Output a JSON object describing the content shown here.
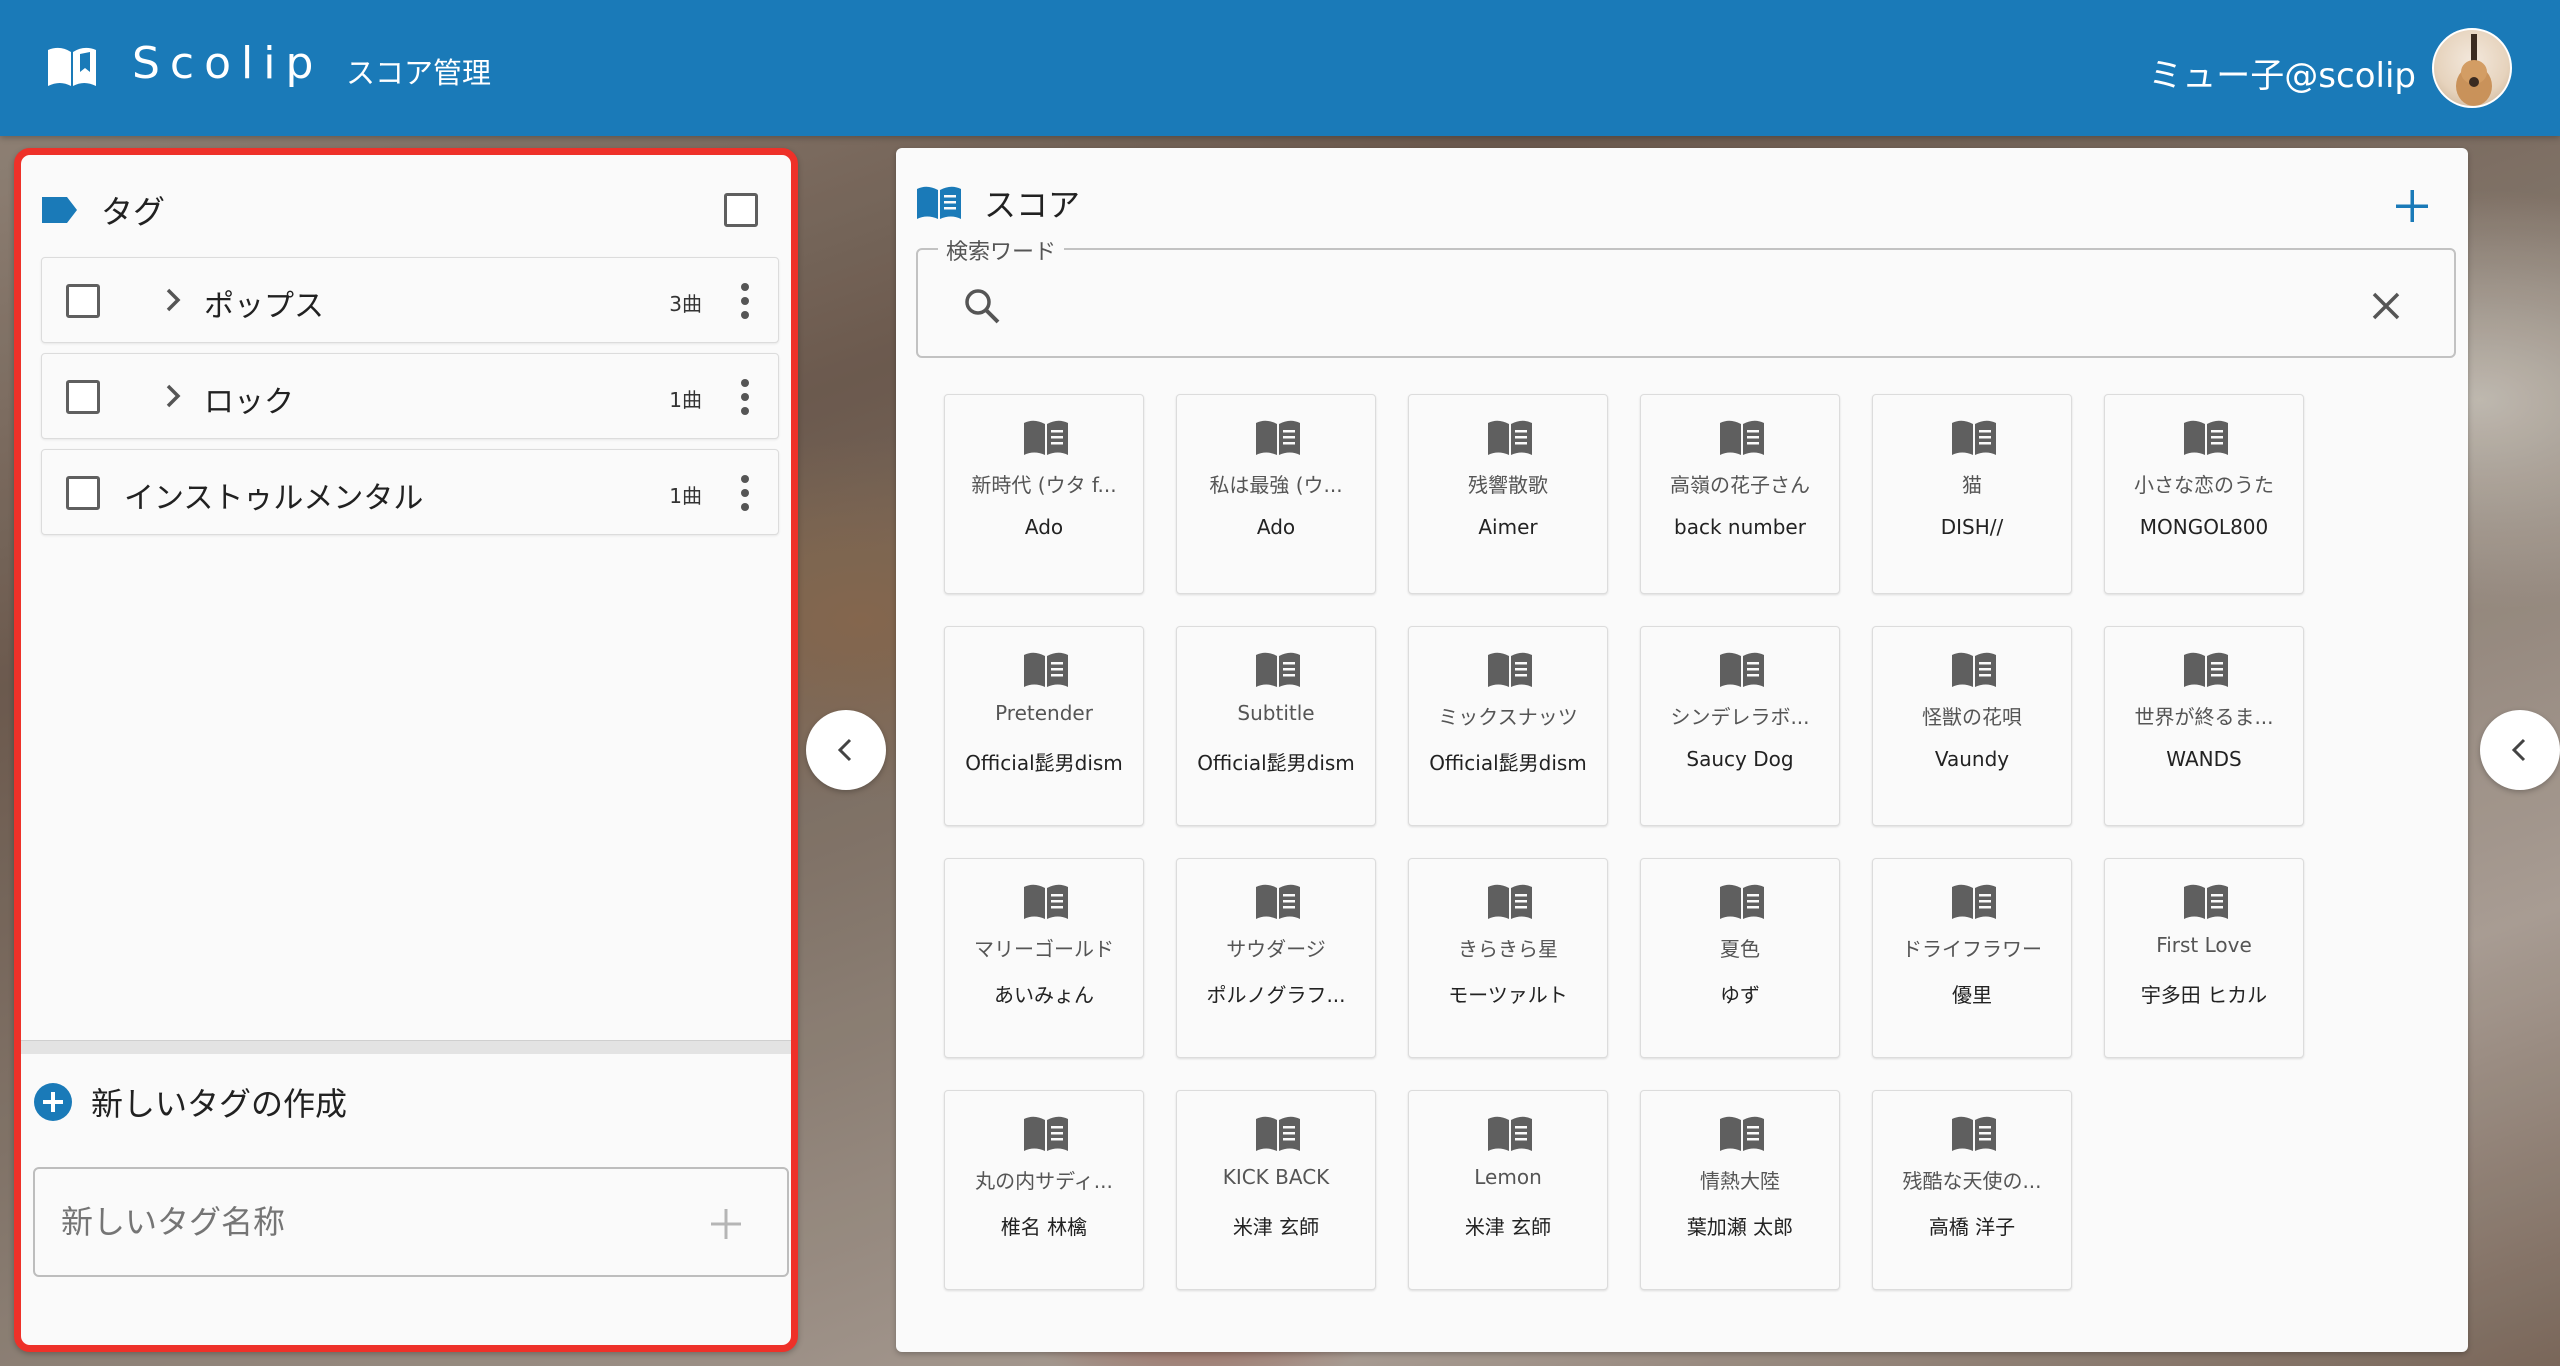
{
  "header": {
    "app_name": "Scolip",
    "nav_link": "スコア管理",
    "user_name": "ミュー子@scolip"
  },
  "tags_panel": {
    "title": "タグ",
    "items": [
      {
        "name": "ポップス",
        "count": "3曲",
        "expandable": true
      },
      {
        "name": "ロック",
        "count": "1曲",
        "expandable": true
      },
      {
        "name": "インストゥルメンタル",
        "count": "1曲",
        "expandable": false
      }
    ],
    "new_tag_heading": "新しいタグの作成",
    "new_tag_placeholder": "新しいタグ名称"
  },
  "scores_panel": {
    "title": "スコア",
    "search_label": "検索ワード",
    "search_value": "",
    "scores": [
      {
        "title": "新時代 (ウタ f...",
        "artist": "Ado"
      },
      {
        "title": "私は最強 (ウ...",
        "artist": "Ado"
      },
      {
        "title": "残響散歌",
        "artist": "Aimer"
      },
      {
        "title": "高嶺の花子さん",
        "artist": "back number"
      },
      {
        "title": "猫",
        "artist": "DISH//"
      },
      {
        "title": "小さな恋のうた",
        "artist": "MONGOL800"
      },
      {
        "title": "Pretender",
        "artist": "Official髭男dism"
      },
      {
        "title": "Subtitle",
        "artist": "Official髭男dism"
      },
      {
        "title": "ミックスナッツ",
        "artist": "Official髭男dism"
      },
      {
        "title": "シンデレラボ...",
        "artist": "Saucy Dog"
      },
      {
        "title": "怪獣の花唄",
        "artist": "Vaundy"
      },
      {
        "title": "世界が終るま...",
        "artist": "WANDS"
      },
      {
        "title": "マリーゴールド",
        "artist": "あいみょん"
      },
      {
        "title": "サウダージ",
        "artist": "ポルノグラフ..."
      },
      {
        "title": "きらきら星",
        "artist": "モーツァルト"
      },
      {
        "title": "夏色",
        "artist": "ゆず"
      },
      {
        "title": "ドライフラワー",
        "artist": "優里"
      },
      {
        "title": "First Love",
        "artist": "宇多田 ヒカル"
      },
      {
        "title": "丸の内サディ...",
        "artist": "椎名 林檎"
      },
      {
        "title": "KICK BACK",
        "artist": "米津 玄師"
      },
      {
        "title": "Lemon",
        "artist": "米津 玄師"
      },
      {
        "title": "情熱大陸",
        "artist": "葉加瀬 太郎"
      },
      {
        "title": "残酷な天使の...",
        "artist": "高橋 洋子"
      }
    ]
  },
  "colors": {
    "primary": "#1a7ab8",
    "highlight_border": "#ee3129"
  }
}
